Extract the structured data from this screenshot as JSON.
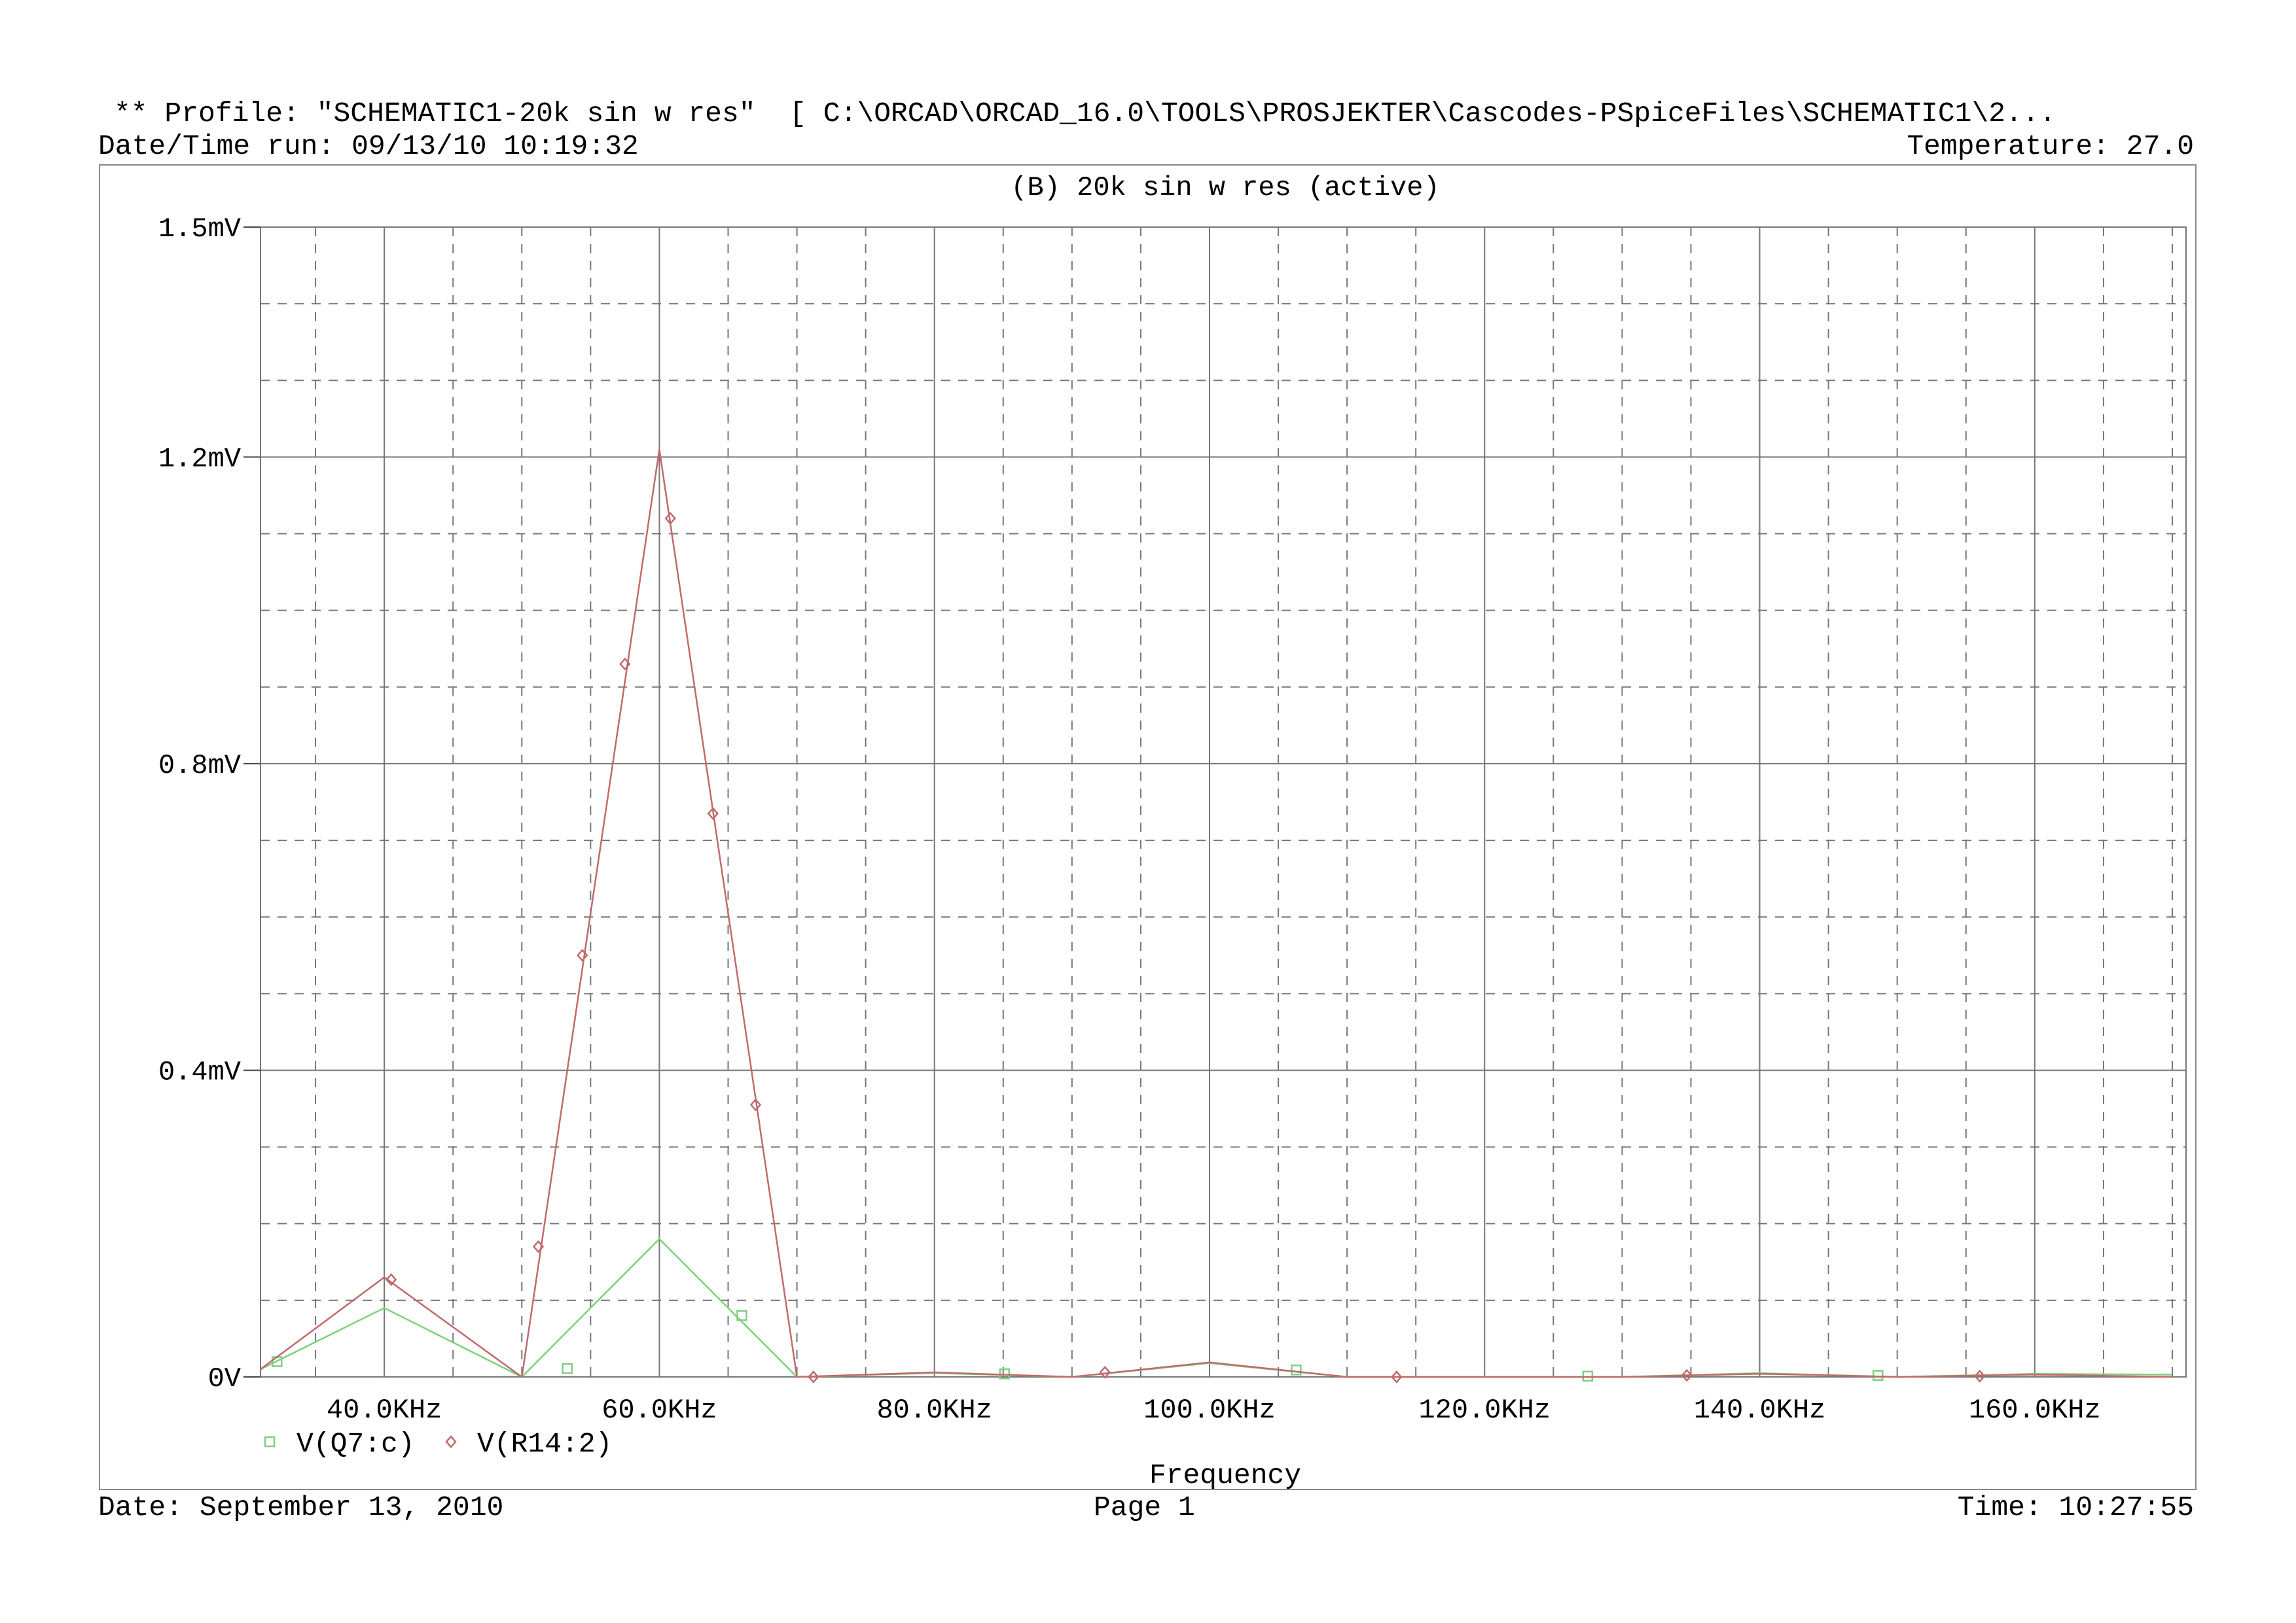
{
  "header": {
    "profile_line": "** Profile: \"SCHEMATIC1-20k sin w res\"  [ C:\\ORCAD\\ORCAD_16.0\\TOOLS\\PROSJEKTER\\Cascodes-PSpiceFiles\\SCHEMATIC1\\2...",
    "datetime_run": "Date/Time run: 09/13/10 10:19:32",
    "temperature": "Temperature: 27.0"
  },
  "footer": {
    "date": "Date: September 13, 2010",
    "page": "Page 1",
    "time": "Time: 10:27:55"
  },
  "colors": {
    "green_trace": "#7fcf7f",
    "red_trace": "#c06a6a",
    "grid": "#777777",
    "frame": "#888888"
  },
  "chart_data": {
    "type": "line",
    "title": "(B) 20k sin w res (active)",
    "xlabel": "Frequency",
    "ylabel": "",
    "xlim": [
      31,
      171
    ],
    "xlim_units": "KHz",
    "ylim": [
      0,
      1.5
    ],
    "ylim_units": "mV",
    "x_ticks": [
      40,
      60,
      80,
      100,
      120,
      140,
      160
    ],
    "x_tick_labels": [
      "40.0KHz",
      "60.0KHz",
      "80.0KHz",
      "100.0KHz",
      "120.0KHz",
      "140.0KHz",
      "160.0KHz"
    ],
    "y_ticks": [
      0,
      0.4,
      0.8,
      1.2,
      1.5
    ],
    "y_tick_labels": [
      "0V",
      "0.4mV",
      "0.8mV",
      "1.2mV",
      "1.5mV"
    ],
    "grid": true,
    "legend_position": "bottom-left",
    "series": [
      {
        "name": "V(Q7:c)",
        "marker": "square",
        "color": "#7fcf7f",
        "x": [
          31,
          40,
          50,
          60,
          70,
          80,
          90,
          100,
          110,
          120,
          130,
          140,
          150,
          160,
          170
        ],
        "y": [
          0.01,
          0.09,
          0.0,
          0.18,
          0.0,
          0.005,
          0.0,
          0.018,
          0.0,
          0.0,
          0.0,
          0.005,
          0.0,
          0.004,
          0.003
        ],
        "marker_x": [
          32.2,
          53.3,
          66.0,
          85.1,
          106.3,
          127.5,
          148.6
        ],
        "marker_y": [
          0.02,
          0.011,
          0.08,
          0.004,
          0.009,
          0.001,
          0.002
        ]
      },
      {
        "name": "V(R14:2)",
        "marker": "diamond",
        "color": "#c06a6a",
        "x": [
          31,
          40,
          50,
          60,
          70,
          80,
          90,
          100,
          110,
          120,
          130,
          140,
          150,
          160,
          170
        ],
        "y": [
          0.01,
          0.13,
          0.0,
          1.21,
          0.0,
          0.006,
          0.0,
          0.019,
          0.0,
          0.0,
          0.0,
          0.004,
          0.0,
          0.003,
          0.0
        ],
        "marker_x": [
          40.5,
          51.2,
          54.4,
          57.5,
          60.8,
          63.9,
          67.0,
          71.2,
          92.4,
          113.6,
          134.7,
          156.0
        ],
        "marker_y": [
          0.127,
          0.17,
          0.55,
          0.93,
          1.12,
          0.735,
          0.355,
          0.0,
          0.006,
          0.0,
          0.002,
          0.001
        ]
      }
    ]
  }
}
